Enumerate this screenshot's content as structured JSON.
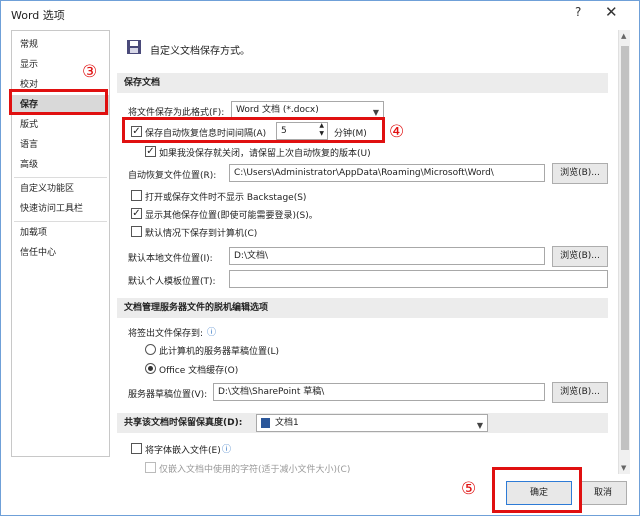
{
  "window": {
    "title": "Word 选项",
    "help": "?",
    "close": "✕"
  },
  "sidebar": {
    "items": [
      "常规",
      "显示",
      "校对",
      "保存",
      "版式",
      "语言",
      "高级",
      "自定义功能区",
      "快速访问工具栏",
      "加载项",
      "信任中心"
    ],
    "active": "保存"
  },
  "header": {
    "title": "自定义文档保存方式。"
  },
  "save_docs": {
    "section_title": "保存文档",
    "format_label": "将文件保存为此格式(F):",
    "format_value": "Word 文档 (*.docx)",
    "autorecover_label": "保存自动恢复信息时间间隔(A)",
    "autorecover_value": "5",
    "minutes_label": "分钟(M)",
    "keep_last_label": "如果我没保存就关闭，请保留上次自动恢复的版本(U)",
    "autorecover_loc_label": "自动恢复文件位置(R):",
    "autorecover_loc_value": "C:\\Users\\Administrator\\AppData\\Roaming\\Microsoft\\Word\\",
    "browse_label": "浏览(B)...",
    "no_backstage_label": "打开或保存文件时不显示 Backstage(S)",
    "show_other_locations_label": "显示其他保存位置(即使可能需要登录)(S)。",
    "save_to_computer_label": "默认情况下保存到计算机(C)",
    "default_local_label": "默认本地文件位置(I):",
    "default_local_value": "D:\\文档\\",
    "templates_label": "默认个人模板位置(T):",
    "templates_value": ""
  },
  "offline": {
    "section_title": "文档管理服务器文件的脱机编辑选项",
    "checkout_label": "将签出文件保存到:",
    "info_icon": "ⓘ",
    "radio_server_label": "此计算机的服务器草稿位置(L)",
    "radio_cache_label": "Office 文档缓存(O)",
    "drafts_label": "服务器草稿位置(V):",
    "drafts_value": "D:\\文档\\SharePoint 草稿\\",
    "browse_label": "浏览(B)..."
  },
  "fidelity": {
    "section_title": "共享该文档时保留保真度(D):",
    "doc_value": "文档1",
    "embed_fonts_label": "将字体嵌入文件(E)",
    "embed_used_label": "仅嵌入文档中使用的字符(适于减小文件大小)(C)"
  },
  "footer": {
    "ok_label": "确定",
    "cancel_label": "取消"
  },
  "annotations": {
    "three": "③",
    "four": "④",
    "five": "⑤"
  },
  "colors": {
    "accent_red": "#e01010",
    "header_bg": "#ececec",
    "sidebar_active": "#d9d9d9"
  }
}
